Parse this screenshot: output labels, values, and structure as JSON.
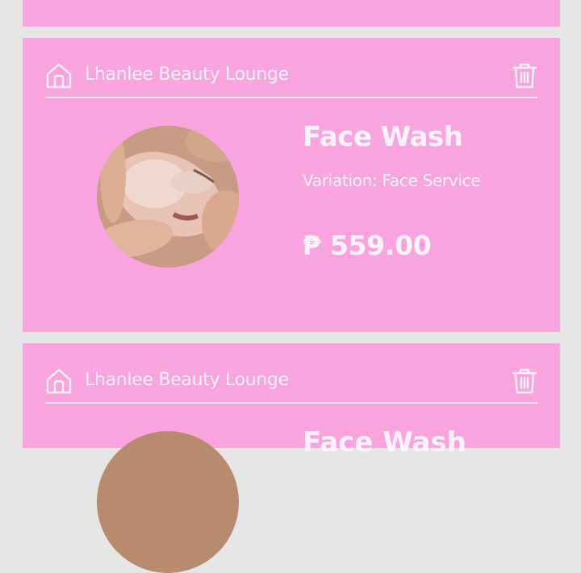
{
  "cart_items": [
    {
      "shop_name": "Lhanlee Beauty Lounge",
      "title": "Face Wash",
      "variation": "Variation: Face Service",
      "price": "₱ 559.00",
      "thumbnail_icon": "facial-treatment-photo"
    },
    {
      "shop_name": "Lhanlee Beauty Lounge",
      "title": "Face Wash",
      "variation": "",
      "price": ""
    }
  ],
  "colors": {
    "background": "#e6e6e6",
    "card": "#f9a4de",
    "text": "#fff3fb"
  },
  "icons": {
    "shop": "home-icon",
    "delete": "trash-icon"
  }
}
